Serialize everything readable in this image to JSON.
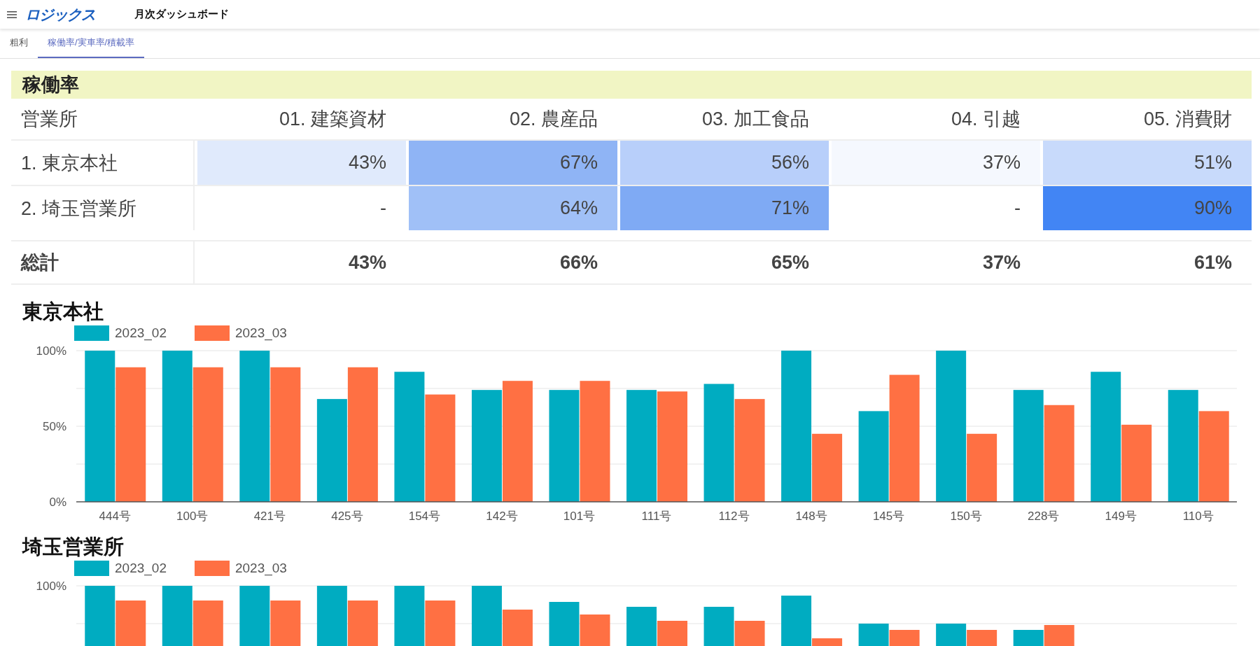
{
  "header": {
    "logo": "ロジックス",
    "title": "月次ダッシュボード"
  },
  "tabs": [
    {
      "label": "粗利",
      "selected": false
    },
    {
      "label": "稼働率/実車率/積載率",
      "selected": true
    }
  ],
  "section_title": "稼働率",
  "table": {
    "columns": [
      "営業所",
      "01. 建築資材",
      "02. 農産品",
      "03. 加工食品",
      "04. 引越",
      "05. 消費財"
    ],
    "rows": [
      {
        "kind": "data",
        "cells": [
          {
            "value": "1. 東京本社"
          },
          {
            "value": "43%",
            "color": "#e0eafc"
          },
          {
            "value": "67%",
            "color": "#8fb4f5"
          },
          {
            "value": "56%",
            "color": "#b8cffa"
          },
          {
            "value": "37%",
            "color": "#f5f8fe"
          },
          {
            "value": "51%",
            "color": "#c8dafb"
          }
        ]
      },
      {
        "kind": "data",
        "cells": [
          {
            "value": "2. 埼玉営業所"
          },
          {
            "value": "-"
          },
          {
            "value": "64%",
            "color": "#a0c0f7"
          },
          {
            "value": "71%",
            "color": "#7faaf4"
          },
          {
            "value": "-"
          },
          {
            "value": "90%",
            "color": "#4285f4"
          }
        ]
      },
      {
        "kind": "total",
        "cells": [
          {
            "value": "総計"
          },
          {
            "value": "43%"
          },
          {
            "value": "66%"
          },
          {
            "value": "65%"
          },
          {
            "value": "37%"
          },
          {
            "value": "61%"
          }
        ]
      }
    ]
  },
  "charts": [
    {
      "title": "東京本社",
      "chart_data": {
        "type": "bar",
        "categories": [
          "444号",
          "100号",
          "421号",
          "425号",
          "154号",
          "142号",
          "101号",
          "111号",
          "112号",
          "148号",
          "145号",
          "150号",
          "228号",
          "149号",
          "110号"
        ],
        "series": [
          {
            "name": "2023_02",
            "color": "#00acc1",
            "values": [
              100,
              100,
              100,
              68,
              86,
              74,
              74,
              74,
              78,
              100,
              60,
              100,
              74,
              86,
              74
            ]
          },
          {
            "name": "2023_03",
            "color": "#ff7043",
            "values": [
              89,
              89,
              89,
              89,
              71,
              80,
              80,
              73,
              68,
              45,
              84,
              45,
              64,
              51,
              60
            ]
          }
        ],
        "ylim": [
          0,
          100
        ],
        "yticks": [
          {
            "value": 0,
            "label": "0%"
          },
          {
            "value": 50,
            "label": "50%"
          },
          {
            "value": 100,
            "label": "100%"
          }
        ]
      }
    },
    {
      "title": "埼玉営業所",
      "legend": [
        {
          "name": "2023_02",
          "color": "#00acc1"
        },
        {
          "name": "2023_03",
          "color": "#ff7043"
        }
      ],
      "y_tick_label": "100%"
    }
  ]
}
